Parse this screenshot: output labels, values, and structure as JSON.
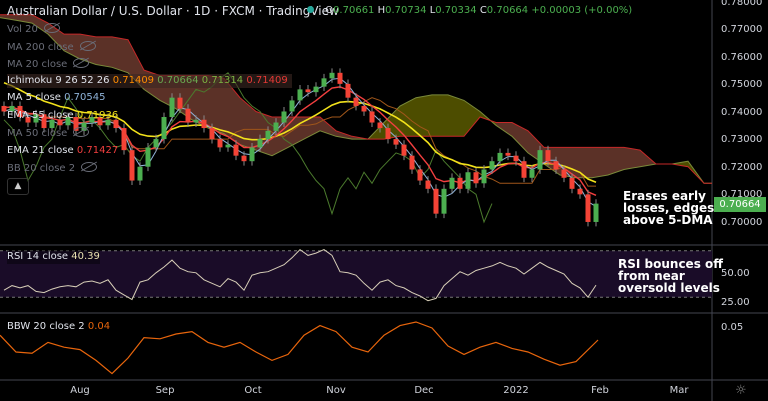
{
  "header": {
    "title": "Australian Dollar / U.S. Dollar · 1D · FXCM · TradingView",
    "open_label": "O",
    "open": "0.70661",
    "high_label": "H",
    "high": "0.70734",
    "low_label": "L",
    "low": "0.70334",
    "close_label": "C",
    "close": "0.70664",
    "change": "+0.00003 (+0.00%)",
    "status_color": "#26a69a"
  },
  "legend": {
    "vol": "Vol 20",
    "ma200": "MA 200 close",
    "ma20": "MA 20 close",
    "ichimoku": "Ichimoku 9 26 52 26",
    "ichimoku_values": [
      "0.71409",
      "0.70664",
      "0.71314",
      "0.71409"
    ],
    "ma5": "MA 5 close",
    "ma5_value": "0.70545",
    "ema55": "EMA 55 close",
    "ema55_value": "0.71936",
    "ma50": "MA 50 close",
    "ema21": "EMA 21 close",
    "ema21_value": "0.71427",
    "bb": "BB 20 close 2",
    "collapse_icon": "chevron-up-icon"
  },
  "rsi_legend": {
    "label": "RSI 14 close",
    "value": "40.39"
  },
  "bbw_legend": {
    "label": "BBW 20 close 2",
    "value": "0.04"
  },
  "annotations": {
    "price_note": "Erases early\nlosses, edges\nabove 5-DMA",
    "rsi_note": "RSI bounces off\nfrom near\noversold levels"
  },
  "price_axis": [
    "0.78000",
    "0.77000",
    "0.76000",
    "0.75000",
    "0.74000",
    "0.73000",
    "0.72000",
    "0.71000",
    "0.70000"
  ],
  "last_price_tag": "0.70664",
  "rsi_axis": [
    "50.00",
    "25.00"
  ],
  "bbw_axis": [
    "0.05"
  ],
  "time_axis": [
    "Aug",
    "Sep",
    "Oct",
    "Nov",
    "Dec",
    "2022",
    "Feb",
    "Mar"
  ],
  "colors": {
    "up": "#26a69a",
    "candle_up": "#4caf50",
    "candle_down": "#f44336",
    "ma5": "#8fb3d9",
    "ema21": "#f23f3f",
    "ema55": "#f2e21b",
    "kumo_bear": "#6b3a2e",
    "kumo_bull": "#5b5a00",
    "chikou": "#4b7a2d",
    "kijun": "#a0561a",
    "rsi": "#d8cfb8",
    "rsi_band": "#1a0c28",
    "bbw": "#e8650c"
  },
  "chart_data": {
    "type": "candlestick",
    "title": "Australian Dollar / U.S. Dollar · 1D · FXCM",
    "ylim": [
      0.695,
      0.78
    ],
    "x_ticks": [
      "Aug",
      "Sep",
      "Oct",
      "Nov",
      "Dec",
      "2022",
      "Feb",
      "Mar"
    ],
    "closes": [
      0.74,
      0.742,
      0.738,
      0.736,
      0.739,
      0.734,
      0.737,
      0.735,
      0.738,
      0.733,
      0.736,
      0.738,
      0.735,
      0.737,
      0.734,
      0.726,
      0.715,
      0.72,
      0.727,
      0.73,
      0.738,
      0.745,
      0.741,
      0.736,
      0.737,
      0.734,
      0.73,
      0.727,
      0.728,
      0.724,
      0.722,
      0.727,
      0.73,
      0.733,
      0.736,
      0.74,
      0.744,
      0.748,
      0.747,
      0.749,
      0.752,
      0.754,
      0.75,
      0.745,
      0.742,
      0.74,
      0.736,
      0.734,
      0.73,
      0.728,
      0.724,
      0.719,
      0.715,
      0.712,
      0.703,
      0.712,
      0.716,
      0.712,
      0.718,
      0.714,
      0.719,
      0.722,
      0.725,
      0.724,
      0.722,
      0.716,
      0.719,
      0.726,
      0.722,
      0.719,
      0.716,
      0.712,
      0.71,
      0.7,
      0.70664
    ],
    "ichimoku_span_a": [
      0.774,
      0.773,
      0.772,
      0.768,
      0.762,
      0.759,
      0.757,
      0.756,
      0.754,
      0.748,
      0.744,
      0.741,
      0.737,
      0.734,
      0.732,
      0.728,
      0.726,
      0.724,
      0.727,
      0.73,
      0.733,
      0.731,
      0.73,
      0.73,
      0.736,
      0.742,
      0.745,
      0.746,
      0.746,
      0.744,
      0.74,
      0.735,
      0.731,
      0.725,
      0.721,
      0.717,
      0.716,
      0.716,
      0.717,
      0.719,
      0.72,
      0.721,
      0.721,
      0.722,
      0.714,
      0.714
    ],
    "ichimoku_span_b": [
      0.775,
      0.775,
      0.775,
      0.772,
      0.768,
      0.768,
      0.767,
      0.767,
      0.766,
      0.755,
      0.753,
      0.753,
      0.753,
      0.753,
      0.752,
      0.745,
      0.74,
      0.738,
      0.738,
      0.738,
      0.738,
      0.733,
      0.731,
      0.73,
      0.73,
      0.731,
      0.731,
      0.731,
      0.731,
      0.731,
      0.738,
      0.736,
      0.736,
      0.733,
      0.727,
      0.727,
      0.727,
      0.727,
      0.727,
      0.727,
      0.726,
      0.721,
      0.721,
      0.72,
      0.714,
      0.714
    ],
    "rsi": {
      "name": "RSI 14",
      "ylim": [
        0,
        100
      ],
      "bands": [
        70,
        30
      ],
      "values": [
        36,
        40,
        38,
        40,
        35,
        34,
        37,
        39,
        40,
        39,
        43,
        44,
        42,
        45,
        36,
        32,
        28,
        43,
        45,
        51,
        56,
        62,
        55,
        52,
        51,
        45,
        42,
        39,
        46,
        43,
        36,
        49,
        51,
        52,
        55,
        58,
        64,
        71,
        66,
        68,
        71,
        66,
        52,
        51,
        49,
        42,
        36,
        43,
        45,
        40,
        38,
        34,
        31,
        27,
        29,
        40,
        46,
        52,
        49,
        53,
        55,
        57,
        60,
        57,
        55,
        50,
        55,
        60,
        56,
        53,
        50,
        42,
        38,
        30,
        40.39
      ]
    },
    "bbw": {
      "name": "BBW 20 close 2",
      "values": [
        0.044,
        0.03,
        0.029,
        0.038,
        0.034,
        0.032,
        0.023,
        0.012,
        0.025,
        0.042,
        0.041,
        0.045,
        0.047,
        0.038,
        0.034,
        0.038,
        0.03,
        0.023,
        0.028,
        0.044,
        0.052,
        0.047,
        0.034,
        0.03,
        0.044,
        0.052,
        0.055,
        0.05,
        0.035,
        0.028,
        0.034,
        0.038,
        0.033,
        0.03,
        0.024,
        0.019,
        0.022,
        0.04
      ]
    }
  }
}
